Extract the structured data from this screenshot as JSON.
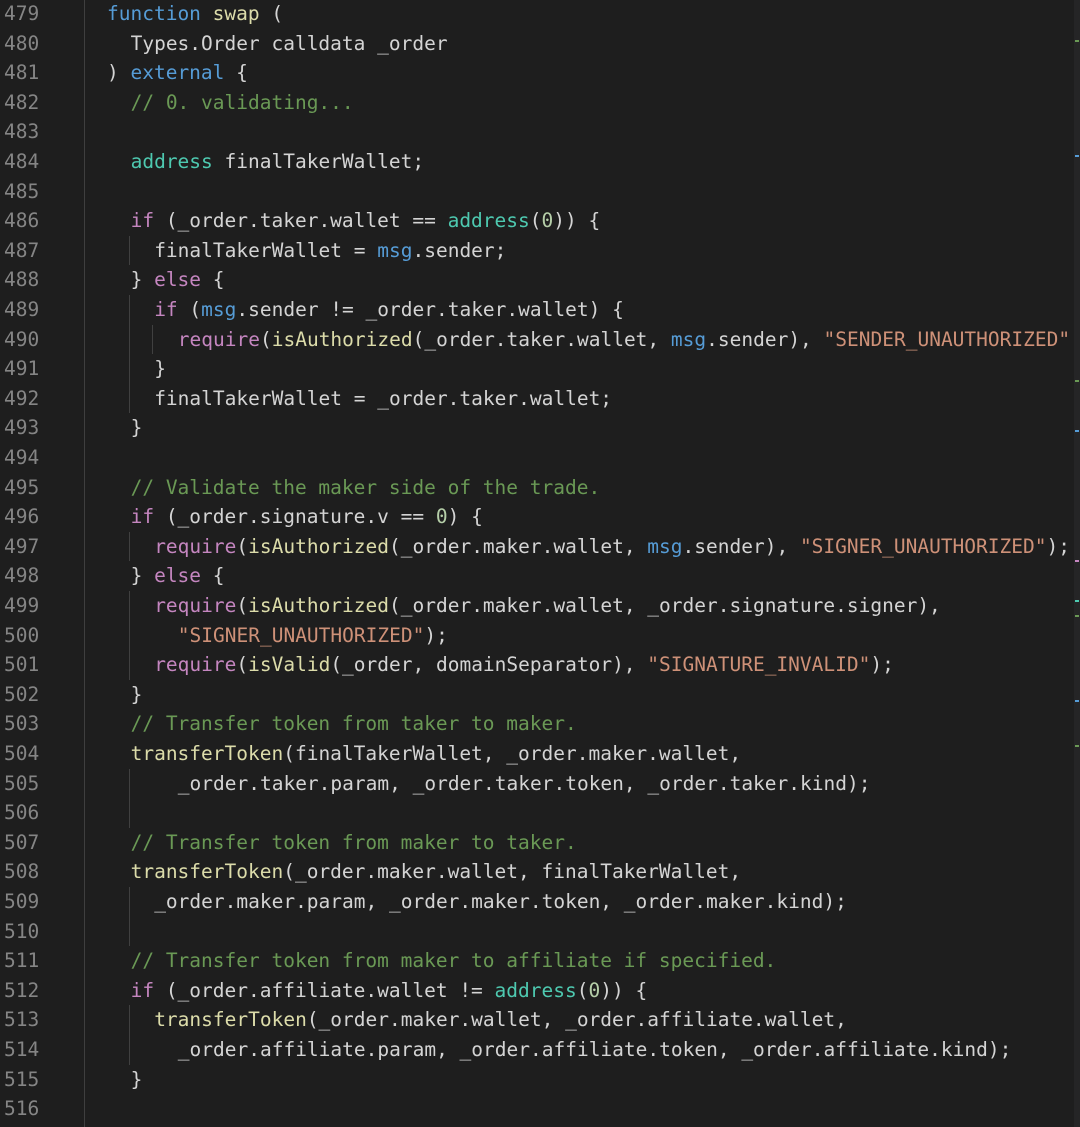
{
  "colors": {
    "background": "#1e1e1e",
    "line_number": "#858585",
    "plain": "#d4d4d4",
    "keyword": "#c586c0",
    "declaration": "#569cd6",
    "type": "#4ec9b0",
    "function": "#dcdcaa",
    "string": "#ce9178",
    "comment": "#6a9955",
    "number": "#b5cea8",
    "variable": "#4fc1ff"
  },
  "lines": [
    {
      "n": "479",
      "indent": 0,
      "guides": 0,
      "tokens": [
        [
          "decl",
          "function"
        ],
        [
          "plain",
          " "
        ],
        [
          "func",
          "swap"
        ],
        [
          "plain",
          " ("
        ]
      ]
    },
    {
      "n": "480",
      "indent": 1,
      "guides": 0,
      "tokens": [
        [
          "plain",
          "Types.Order calldata _order"
        ]
      ]
    },
    {
      "n": "481",
      "indent": 0,
      "guides": 0,
      "tokens": [
        [
          "plain",
          ") "
        ],
        [
          "decl",
          "external"
        ],
        [
          "plain",
          " {"
        ]
      ]
    },
    {
      "n": "482",
      "indent": 1,
      "guides": 0,
      "tokens": [
        [
          "comment",
          "// 0. validating..."
        ]
      ]
    },
    {
      "n": "483",
      "indent": 0,
      "guides": 0,
      "tokens": []
    },
    {
      "n": "484",
      "indent": 1,
      "guides": 0,
      "tokens": [
        [
          "type",
          "address"
        ],
        [
          "plain",
          " finalTakerWallet;"
        ]
      ]
    },
    {
      "n": "485",
      "indent": 0,
      "guides": 0,
      "tokens": []
    },
    {
      "n": "486",
      "indent": 1,
      "guides": 0,
      "tokens": [
        [
          "keyword",
          "if"
        ],
        [
          "plain",
          " (_order.taker.wallet == "
        ],
        [
          "type",
          "address"
        ],
        [
          "plain",
          "("
        ],
        [
          "number",
          "0"
        ],
        [
          "plain",
          ")) {"
        ]
      ]
    },
    {
      "n": "487",
      "indent": 2,
      "guides": 1,
      "tokens": [
        [
          "plain",
          "finalTakerWallet = "
        ],
        [
          "var2",
          "msg"
        ],
        [
          "plain",
          ".sender;"
        ]
      ]
    },
    {
      "n": "488",
      "indent": 1,
      "guides": 0,
      "tokens": [
        [
          "plain",
          "} "
        ],
        [
          "keyword",
          "else"
        ],
        [
          "plain",
          " {"
        ]
      ]
    },
    {
      "n": "489",
      "indent": 2,
      "guides": 1,
      "tokens": [
        [
          "keyword",
          "if"
        ],
        [
          "plain",
          " ("
        ],
        [
          "var2",
          "msg"
        ],
        [
          "plain",
          ".sender != _order.taker.wallet) {"
        ]
      ]
    },
    {
      "n": "490",
      "indent": 3,
      "guides": 2,
      "tokens": [
        [
          "keyword",
          "require"
        ],
        [
          "plain",
          "("
        ],
        [
          "func",
          "isAuthorized"
        ],
        [
          "plain",
          "(_order.taker.wallet, "
        ],
        [
          "var2",
          "msg"
        ],
        [
          "plain",
          ".sender), "
        ],
        [
          "string",
          "\"SENDER_UNAUTHORIZED\""
        ]
      ]
    },
    {
      "n": "491",
      "indent": 2,
      "guides": 1,
      "tokens": [
        [
          "plain",
          "}"
        ]
      ]
    },
    {
      "n": "492",
      "indent": 2,
      "guides": 1,
      "tokens": [
        [
          "plain",
          "finalTakerWallet = _order.taker.wallet;"
        ]
      ]
    },
    {
      "n": "493",
      "indent": 1,
      "guides": 0,
      "tokens": [
        [
          "plain",
          "}"
        ]
      ]
    },
    {
      "n": "494",
      "indent": 0,
      "guides": 0,
      "tokens": []
    },
    {
      "n": "495",
      "indent": 1,
      "guides": 0,
      "tokens": [
        [
          "comment",
          "// Validate the maker side of the trade."
        ]
      ]
    },
    {
      "n": "496",
      "indent": 1,
      "guides": 0,
      "tokens": [
        [
          "keyword",
          "if"
        ],
        [
          "plain",
          " (_order.signature.v == "
        ],
        [
          "number",
          "0"
        ],
        [
          "plain",
          ") {"
        ]
      ]
    },
    {
      "n": "497",
      "indent": 2,
      "guides": 1,
      "tokens": [
        [
          "keyword",
          "require"
        ],
        [
          "plain",
          "("
        ],
        [
          "func",
          "isAuthorized"
        ],
        [
          "plain",
          "(_order.maker.wallet, "
        ],
        [
          "var2",
          "msg"
        ],
        [
          "plain",
          ".sender), "
        ],
        [
          "string",
          "\"SIGNER_UNAUTHORIZED\""
        ],
        [
          "plain",
          ");"
        ]
      ]
    },
    {
      "n": "498",
      "indent": 1,
      "guides": 0,
      "tokens": [
        [
          "plain",
          "} "
        ],
        [
          "keyword",
          "else"
        ],
        [
          "plain",
          " {"
        ]
      ]
    },
    {
      "n": "499",
      "indent": 2,
      "guides": 1,
      "tokens": [
        [
          "keyword",
          "require"
        ],
        [
          "plain",
          "("
        ],
        [
          "func",
          "isAuthorized"
        ],
        [
          "plain",
          "(_order.maker.wallet, _order.signature.signer),"
        ]
      ]
    },
    {
      "n": "500",
      "indent": 3,
      "guides": 1,
      "tokens": [
        [
          "string",
          "\"SIGNER_UNAUTHORIZED\""
        ],
        [
          "plain",
          ");"
        ]
      ]
    },
    {
      "n": "501",
      "indent": 2,
      "guides": 1,
      "tokens": [
        [
          "keyword",
          "require"
        ],
        [
          "plain",
          "("
        ],
        [
          "func",
          "isValid"
        ],
        [
          "plain",
          "(_order, domainSeparator), "
        ],
        [
          "string",
          "\"SIGNATURE_INVALID\""
        ],
        [
          "plain",
          ");"
        ]
      ]
    },
    {
      "n": "502",
      "indent": 1,
      "guides": 0,
      "tokens": [
        [
          "plain",
          "}"
        ]
      ]
    },
    {
      "n": "503",
      "indent": 1,
      "guides": 0,
      "tokens": [
        [
          "comment",
          "// Transfer token from taker to maker."
        ]
      ]
    },
    {
      "n": "504",
      "indent": 1,
      "guides": 0,
      "tokens": [
        [
          "func",
          "transferToken"
        ],
        [
          "plain",
          "(finalTakerWallet, _order.maker.wallet,"
        ]
      ]
    },
    {
      "n": "505",
      "indent": 3,
      "guides": 1,
      "tokens": [
        [
          "plain",
          "_order.taker.param, _order.taker.token, _order.taker.kind);"
        ]
      ]
    },
    {
      "n": "506",
      "indent": 0,
      "guides": 1,
      "tokens": []
    },
    {
      "n": "507",
      "indent": 1,
      "guides": 0,
      "tokens": [
        [
          "comment",
          "// Transfer token from maker to taker."
        ]
      ]
    },
    {
      "n": "508",
      "indent": 1,
      "guides": 0,
      "tokens": [
        [
          "func",
          "transferToken"
        ],
        [
          "plain",
          "(_order.maker.wallet, finalTakerWallet,"
        ]
      ]
    },
    {
      "n": "509",
      "indent": 2,
      "guides": 1,
      "tokens": [
        [
          "plain",
          "_order.maker.param, _order.maker.token, _order.maker.kind);"
        ]
      ]
    },
    {
      "n": "510",
      "indent": 0,
      "guides": 1,
      "tokens": []
    },
    {
      "n": "511",
      "indent": 1,
      "guides": 0,
      "tokens": [
        [
          "comment",
          "// Transfer token from maker to affiliate if specified."
        ]
      ]
    },
    {
      "n": "512",
      "indent": 1,
      "guides": 0,
      "tokens": [
        [
          "keyword",
          "if"
        ],
        [
          "plain",
          " (_order.affiliate.wallet != "
        ],
        [
          "type",
          "address"
        ],
        [
          "plain",
          "("
        ],
        [
          "number",
          "0"
        ],
        [
          "plain",
          ")) {"
        ]
      ]
    },
    {
      "n": "513",
      "indent": 2,
      "guides": 1,
      "tokens": [
        [
          "func",
          "transferToken"
        ],
        [
          "plain",
          "(_order.maker.wallet, _order.affiliate.wallet,"
        ]
      ]
    },
    {
      "n": "514",
      "indent": 3,
      "guides": 1,
      "tokens": [
        [
          "plain",
          "_order.affiliate.param, _order.affiliate.token, _order.affiliate.kind);"
        ]
      ]
    },
    {
      "n": "515",
      "indent": 1,
      "guides": 0,
      "tokens": [
        [
          "plain",
          "}"
        ]
      ]
    },
    {
      "n": "516",
      "indent": 0,
      "guides": 0,
      "tokens": []
    }
  ]
}
